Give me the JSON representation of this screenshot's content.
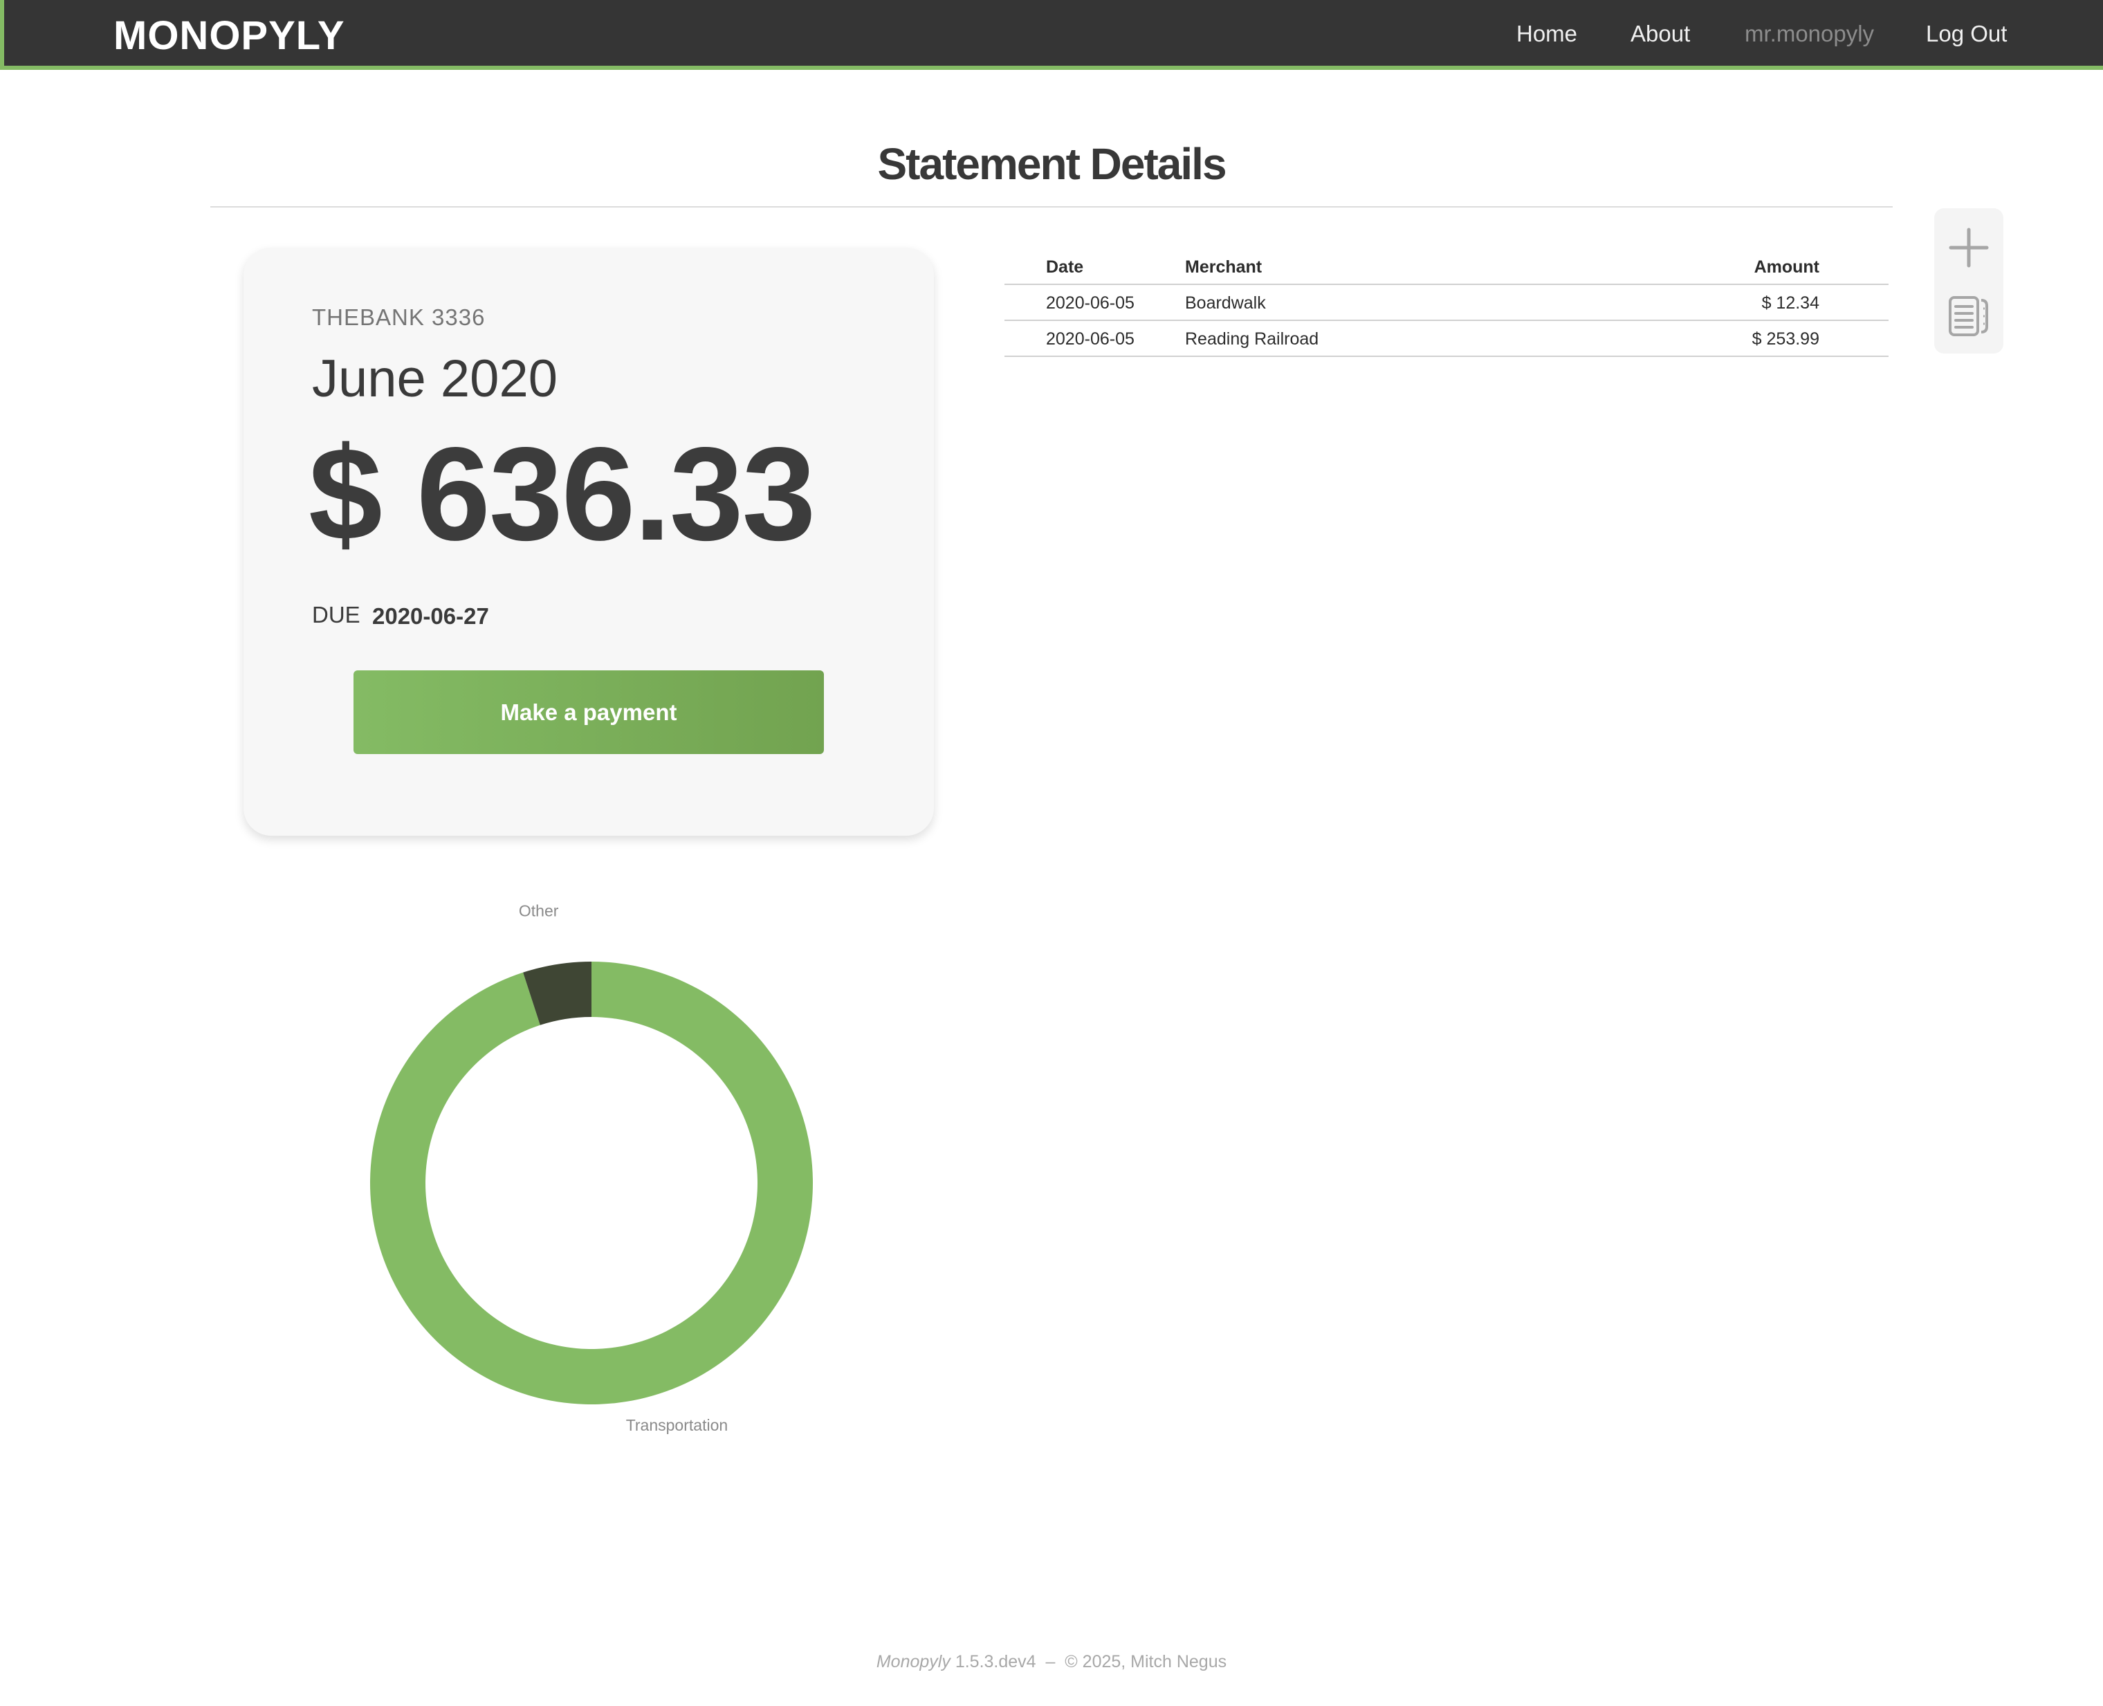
{
  "header": {
    "brand": "MONOPYLY",
    "nav": {
      "home": "Home",
      "about": "About",
      "user": "mr.monopyly",
      "logout": "Log Out"
    },
    "accent_color": "#84bb64",
    "background_color": "#353535"
  },
  "page": {
    "title": "Statement Details"
  },
  "statement": {
    "bank": "THEBANK 3336",
    "period": "June 2020",
    "balance": "$ 636.33",
    "due_label": "DUE",
    "due_date": "2020-06-27",
    "payment_button": "Make a payment"
  },
  "transactions": {
    "columns": [
      "Date",
      "Merchant",
      "Amount"
    ],
    "rows": [
      {
        "date": "2020-06-05",
        "merchant": "Boardwalk",
        "amount": "$ 12.34"
      },
      {
        "date": "2020-06-05",
        "merchant": "Reading Railroad",
        "amount": "$ 253.99"
      }
    ]
  },
  "tools": {
    "add_icon": "plus-icon",
    "statements_icon": "statements-icon"
  },
  "chart_data": {
    "type": "pie",
    "style": "donut",
    "categories": [
      "Transportation",
      "Other"
    ],
    "values": [
      95,
      5
    ],
    "colors": [
      "#84bb64",
      "#3f4634"
    ],
    "legend": "none",
    "labels_position": "outside"
  },
  "footer": {
    "app_name": "Monopyly",
    "version": "1.5.3.dev4",
    "separator": "–",
    "copyright": "© 2025, Mitch Negus"
  }
}
